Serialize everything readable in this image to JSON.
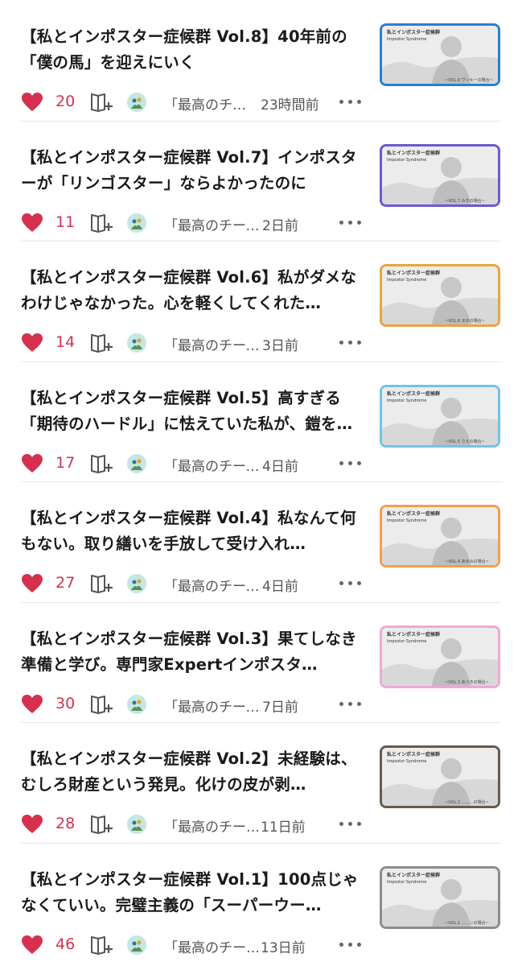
{
  "articles": [
    {
      "title": "【私とインポスター症候群 Vol.8】40年前の「僕の馬」を迎えにいく",
      "likes": "20",
      "magazine": "「最高のチ…",
      "time": "23時間前",
      "thumb": {
        "label": "私とインポスター症候群",
        "sub": "Impostor Syndrome",
        "caption": "~VOL.8 ヴッキーの場合~",
        "border": "#2a7ed6"
      }
    },
    {
      "title": "【私とインポスター症候群 Vol.7】インポスターが「リンゴスター」ならよかったのに",
      "likes": "11",
      "magazine": "「最高のチーム…",
      "time": "2日前",
      "thumb": {
        "label": "私とインポスター症候群",
        "sub": "Impostor Syndrome",
        "caption": "~VOL.7 みきの場合~",
        "border": "#6f57d3"
      }
    },
    {
      "title": "【私とインポスター症候群 Vol.6】私がダメなわけじゃなかった。心を軽くしてくれた…",
      "likes": "14",
      "magazine": "「最高のチーム…",
      "time": "3日前",
      "thumb": {
        "label": "私とインポスター症候群",
        "sub": "Impostor Syndrome",
        "caption": "~VOL.6 まゆの場合~",
        "border": "#e8a63a"
      }
    },
    {
      "title": "【私とインポスター症候群 Vol.5】高すぎる「期待のハードル」に怯えていた私が、鎧を…",
      "likes": "17",
      "magazine": "「最高のチーム…",
      "time": "4日前",
      "thumb": {
        "label": "私とインポスター症候群",
        "sub": "Impostor Syndrome",
        "caption": "~VOL.5 りえの場合~",
        "border": "#6fc3ea"
      }
    },
    {
      "title": "【私とインポスター症候群 Vol.4】私なんて何もない。取り繕いを手放して受け入れ…",
      "likes": "27",
      "magazine": "「最高のチーム…",
      "time": "4日前",
      "thumb": {
        "label": "私とインポスター症候群",
        "sub": "Impostor Syndrome",
        "caption": "~VOL.4 あゆみの場合~",
        "border": "#f2a04a"
      }
    },
    {
      "title": "【私とインポスター症候群 Vol.3】果てしなき準備と学び。専門家Expertインポスタ…",
      "likes": "30",
      "magazine": "「最高のチーム…",
      "time": "7日前",
      "thumb": {
        "label": "私とインポスター症候群",
        "sub": "Impostor Syndrome",
        "caption": "~VOL.3 あべきの場合~",
        "border": "#f0a8d6"
      }
    },
    {
      "title": "【私とインポスター症候群 Vol.2】未経験は、むしろ財産という発見。化けの皮が剥…",
      "likes": "28",
      "magazine": "「最高のチー…",
      "time": "11日前",
      "thumb": {
        "label": "私とインポスター症候群",
        "sub": "Impostor Syndrome",
        "caption": "~VOL.2 ………の場合~",
        "border": "#6a5a4a"
      }
    },
    {
      "title": "【私とインポスター症候群 Vol.1】100点じゃなくていい。完璧主義の「スーパーウー…",
      "likes": "46",
      "magazine": "「最高のチー…",
      "time": "13日前",
      "thumb": {
        "label": "私とインポスター症候群",
        "sub": "Impostor Syndrome",
        "caption": "~VOL.1 ……ンの場合~",
        "border": "#8c8c8c"
      }
    }
  ],
  "colors": {
    "heart": "#d6304f",
    "likes_text": "#d6304f",
    "icon": "#555555"
  },
  "icons": {
    "like": "heart-icon",
    "save": "magazine-add-icon",
    "more": "more-dots-icon"
  }
}
